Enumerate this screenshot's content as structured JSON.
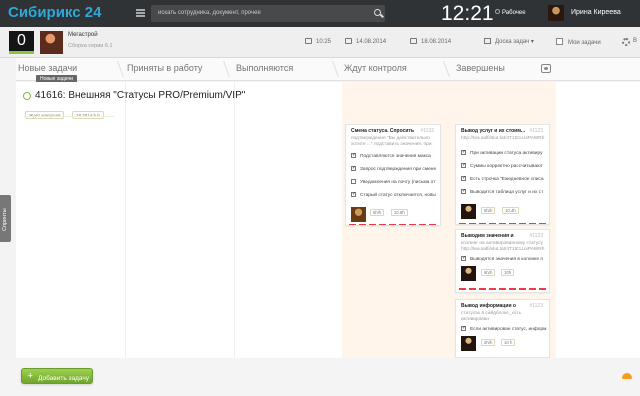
{
  "topbar": {
    "logo_main": "Сибирикс",
    "logo_number": "24",
    "search_placeholder": "искать сотрудника, документ, прочее",
    "time": "12:21",
    "worktime_label": "Рабочее",
    "user_name": "Ирина Киреева"
  },
  "subbar": {
    "counter": "0",
    "group_name": "Мегастрой",
    "group_sub": "Сборка серии 6.1",
    "time_label": "10:25",
    "date_start": "14.08.2014",
    "date_end": "18.08.2014",
    "board_label": "Доска задач",
    "my_tasks_label": "Мои задачи",
    "more_label": "В"
  },
  "columns": [
    {
      "label": "Новые задачи"
    },
    {
      "label": "Приняты в работу"
    },
    {
      "label": "Выполняются"
    },
    {
      "label": "Ждут контроля"
    },
    {
      "label": "Завершены"
    }
  ],
  "tooltip": "Новые задачи",
  "sidebar_label": "Спринты",
  "task": {
    "title": "41616: Внешняя \"Статусы PRO/Premium/VIP\"",
    "tags": [
      "Ждет контроля",
      "18.2014 h h"
    ]
  },
  "cards": {
    "card1": {
      "title": "Смена статуса. Спросить",
      "id": "#1132",
      "desc": [
        "подтверждения \"Вы действительно",
        "хотите ...\" подставить значения, при"
      ],
      "items": [
        "Подставляются значения макса",
        "Запрос подтверждения при смене",
        "Уведомления на почту (письма от",
        "Старый статус отключается, новы"
      ],
      "tags": [
        "5h/h",
        "10.8h"
      ]
    },
    "card2": {
      "title": "Вывод услуг и их стоим...",
      "id": "#1123",
      "desc": [
        "http://tea.salfi/slut.tat/4T1tCLUxPAWRh"
      ],
      "items": [
        "При активации статуса активиру",
        "Суммы корректно рассчитывают",
        "Есть строчка \"Ежедневное списа",
        "Выводится таблица услуг и их ст"
      ],
      "tags": [
        "8h/h",
        "10.4h"
      ]
    },
    "card3": {
      "title": "Выводим значения и",
      "id": "#1123",
      "desc": [
        "коэлинг на активированному статусу",
        "http://tea.salfi/slut.tat/4T1tCLUxPAWRh"
      ],
      "items": [
        "Выводятся значения в колонке п"
      ],
      "tags": [
        "6h/h",
        "10h"
      ]
    },
    "card4": {
      "title": "Вывод информации о",
      "id": "#1123",
      "desc": [
        "статусах в сайдблоке_хоть",
        "активирован"
      ],
      "items": [
        "Если активирован статус, информ"
      ],
      "tags": [
        "2h/h",
        "10 h"
      ]
    }
  },
  "footer": {
    "add_task_label": "Добавить задачу"
  }
}
